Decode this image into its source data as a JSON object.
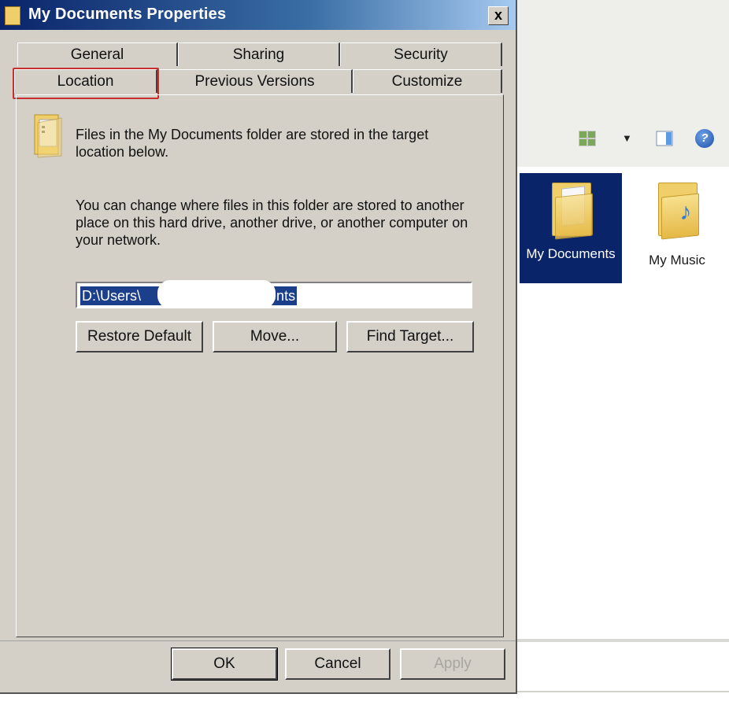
{
  "dialog": {
    "title": "My Documents Properties",
    "close_glyph": "x",
    "tabs_row1": [
      "General",
      "Sharing",
      "Security"
    ],
    "tabs_row2": [
      "Location",
      "Previous Versions",
      "Customize"
    ],
    "active_tab": "Location",
    "info_text": "Files in the My Documents folder are stored in the target location below.",
    "desc_text": "You can change where files in this folder are stored to another place on this hard drive, another drive, or another computer on your network.",
    "path_value": "D:\\Users\\                    \\Documents",
    "buttons": {
      "restore_default": "Restore Default",
      "move": "Move...",
      "find_target": "Find Target..."
    },
    "footer": {
      "ok": "OK",
      "cancel": "Cancel",
      "apply": "Apply"
    }
  },
  "explorer": {
    "items": [
      {
        "label": "My Documents",
        "selected": true
      },
      {
        "label": "My Music",
        "selected": false
      }
    ]
  },
  "colors": {
    "highlight": "#c8302f",
    "selection": "#1c3f8c",
    "titlebar": "#0a246a"
  }
}
